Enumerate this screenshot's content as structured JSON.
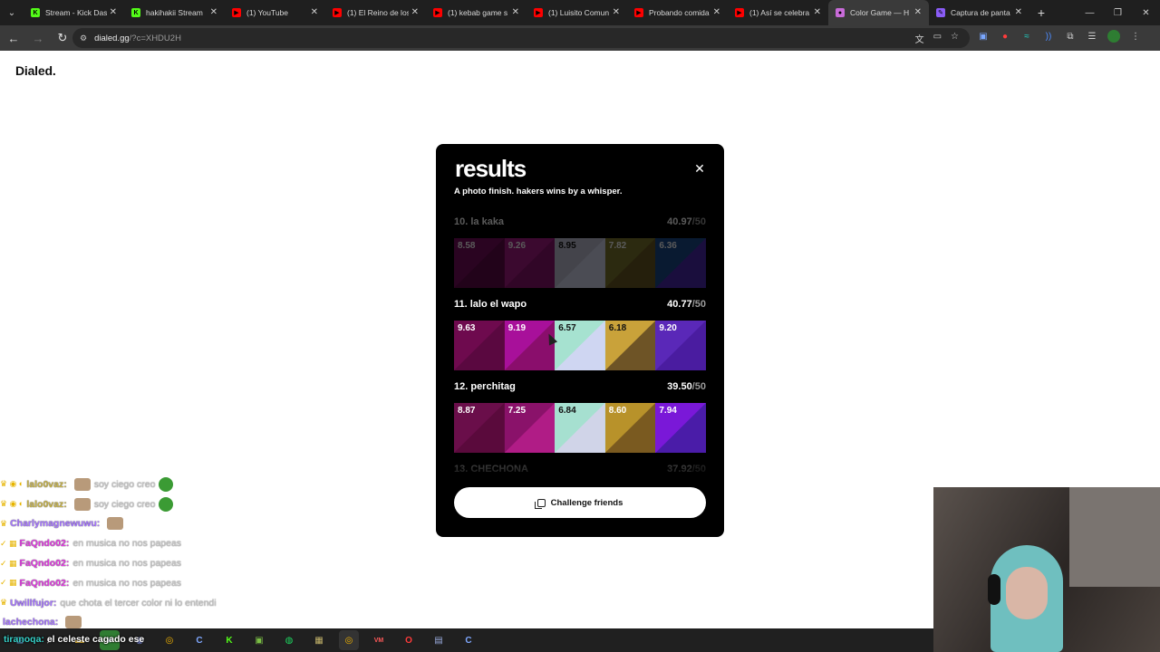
{
  "browser": {
    "tabs": [
      {
        "title": "Stream - Kick Das",
        "fav_color": "#53fc18",
        "fav_glyph": "K",
        "active": false
      },
      {
        "title": "hakihakii Stream",
        "fav_color": "#53fc18",
        "fav_glyph": "K",
        "active": false
      },
      {
        "title": "(1) YouTube",
        "fav_color": "#ff0000",
        "fav_glyph": "▶",
        "active": false
      },
      {
        "title": "(1) El Reino de los",
        "fav_color": "#ff0000",
        "fav_glyph": "▶",
        "active": false
      },
      {
        "title": "(1) kebab game s",
        "fav_color": "#ff0000",
        "fav_glyph": "▶",
        "active": false
      },
      {
        "title": "(1) Luisito Comun",
        "fav_color": "#ff0000",
        "fav_glyph": "▶",
        "active": false
      },
      {
        "title": "Probando comida",
        "fav_color": "#ff0000",
        "fav_glyph": "▶",
        "active": false
      },
      {
        "title": "(1) Así se celebra",
        "fav_color": "#ff0000",
        "fav_glyph": "▶",
        "active": false
      },
      {
        "title": "Color Game — H",
        "fav_color": "#c86bd8",
        "fav_glyph": "●",
        "active": true
      },
      {
        "title": "Captura de panta",
        "fav_color": "#8a5cf6",
        "fav_glyph": "✎",
        "active": false
      }
    ],
    "url_host": "dialed.gg",
    "url_path": "/?c=XHDU2H"
  },
  "page": {
    "brand": "Dialed."
  },
  "modal": {
    "title": "results",
    "subtitle": "A photo finish. hakers wins by a whisper.",
    "results": [
      {
        "rank_name": "10. la kaka",
        "score": "40.97",
        "max": "/50",
        "dim": true,
        "swatches": [
          {
            "value": "8.58",
            "base": "#7a0c5e",
            "tri": "#620a4b",
            "dark_text": false
          },
          {
            "value": "9.26",
            "base": "#a81a86",
            "tri": "#8e126f",
            "dark_text": false
          },
          {
            "value": "8.95",
            "base": "#c4c4d6",
            "tri": "#d6d9f0",
            "dark_text": true
          },
          {
            "value": "7.82",
            "base": "#7e7a2e",
            "tri": "#6c5a24",
            "dark_text": false
          },
          {
            "value": "6.36",
            "base": "#1c4a8c",
            "tri": "#4a2ab0",
            "dark_text": false
          }
        ]
      },
      {
        "rank_name": "11. lalo el wapo",
        "score": "40.77",
        "max": "/50",
        "dim": false,
        "swatches": [
          {
            "value": "9.63",
            "base": "#6e0a4e",
            "tri": "#5a0840",
            "dark_text": false
          },
          {
            "value": "9.19",
            "base": "#a8109a",
            "tri": "#8a0e6c",
            "dark_text": false
          },
          {
            "value": "6.57",
            "base": "#a6e2d0",
            "tri": "#cfd6f2",
            "dark_text": true
          },
          {
            "value": "6.18",
            "base": "#c9a23a",
            "tri": "#6e5426",
            "dark_text": true
          },
          {
            "value": "9.20",
            "base": "#5a28b8",
            "tri": "#4a1ca0",
            "dark_text": false
          }
        ]
      },
      {
        "rank_name": "12. perchitag",
        "score": "39.50",
        "max": "/50",
        "dim": false,
        "swatches": [
          {
            "value": "8.87",
            "base": "#6a0e4a",
            "tri": "#5a0a3c",
            "dark_text": false
          },
          {
            "value": "7.25",
            "base": "#8a126a",
            "tri": "#b01c86",
            "dark_text": false
          },
          {
            "value": "6.84",
            "base": "#a6e0d0",
            "tri": "#d0d4e8",
            "dark_text": true
          },
          {
            "value": "8.60",
            "base": "#b8922a",
            "tri": "#7a5a20",
            "dark_text": false
          },
          {
            "value": "7.94",
            "base": "#7a18d8",
            "tri": "#4a1ca8",
            "dark_text": false
          }
        ]
      },
      {
        "rank_name": "13. CHECHONA",
        "score": "37.92",
        "max": "/50",
        "dim": true,
        "swatches": []
      }
    ],
    "challenge_label": "Challenge friends"
  },
  "chat": [
    {
      "badges": "♛ ◉ ◐",
      "user": "lalo0vaz:",
      "user_color": "#c7b34a",
      "msg": "soy ciego creo",
      "emote": true,
      "green": true
    },
    {
      "badges": "♛ ◉ ◐",
      "user": "lalo0vaz:",
      "user_color": "#c7b34a",
      "msg": "soy ciego creo",
      "emote": true,
      "green": true
    },
    {
      "badges": "♛",
      "user": "Charlymagnewuwu:",
      "user_color": "#a676ff",
      "msg": "",
      "emote": true,
      "green": false
    },
    {
      "badges": "✓ ▦",
      "user": "FaQndo02:",
      "user_color": "#e03ce0",
      "msg": "en musica no nos papeas",
      "emote": false,
      "green": false
    },
    {
      "badges": "✓ ▦",
      "user": "FaQndo02:",
      "user_color": "#e03ce0",
      "msg": "en musica no nos papeas",
      "emote": false,
      "green": false
    },
    {
      "badges": "✓ ▦",
      "user": "FaQndo02:",
      "user_color": "#e03ce0",
      "msg": "en musica no nos papeas",
      "emote": false,
      "green": false
    },
    {
      "badges": "♛",
      "user": "Uwillfujor:",
      "user_color": "#a676ff",
      "msg": "que chota el tercer color ni lo entendi",
      "emote": false,
      "green": false
    },
    {
      "badges": "",
      "user": "lachechona:",
      "user_color": "#a676ff",
      "msg": "",
      "emote": true,
      "green": false
    }
  ],
  "subtitle_overlay": {
    "user": "tiranoqa:",
    "msg": "el celeste cagado ese"
  }
}
